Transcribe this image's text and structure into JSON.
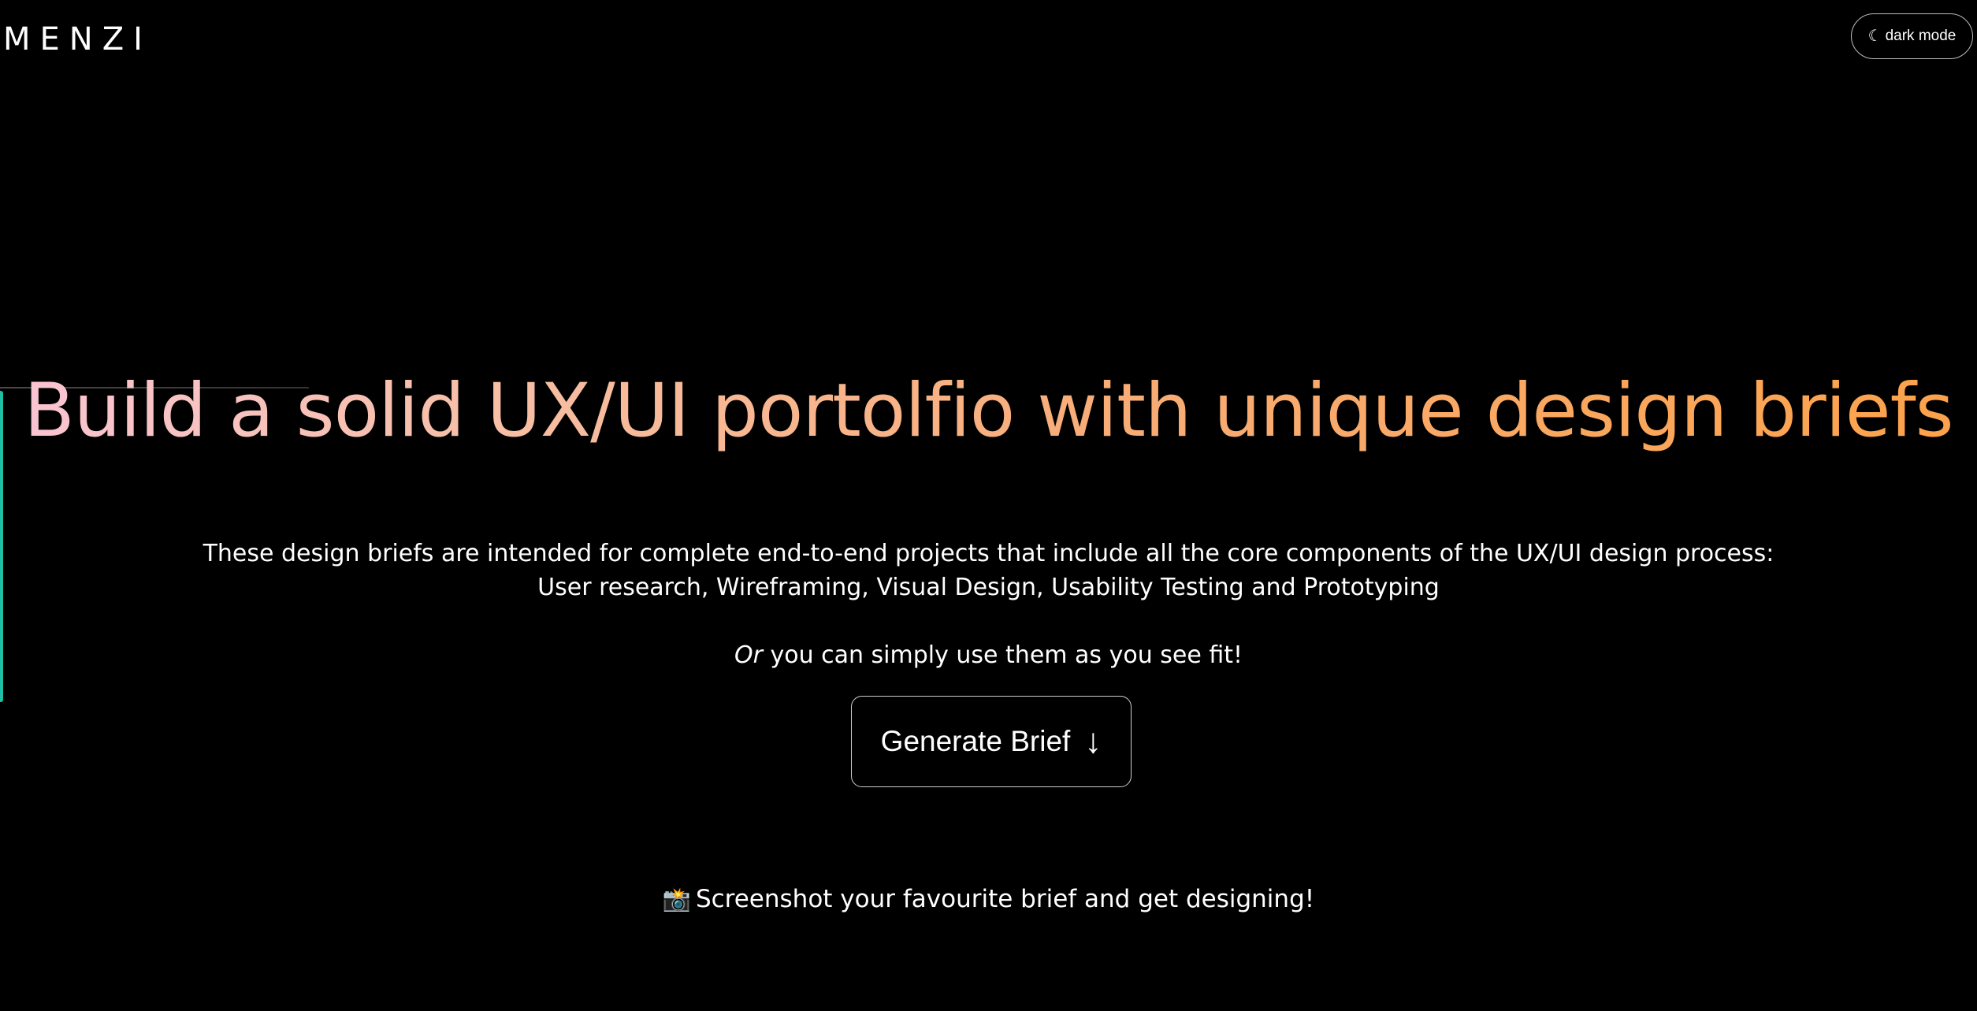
{
  "header": {
    "logo_text": "MENZI",
    "mode_toggle": {
      "icon": "moon-icon",
      "label": "dark mode"
    }
  },
  "hero": {
    "headline": "Build a solid UX/UI portolfio with unique design briefs",
    "intro_line_1": "These design briefs are intended for complete end-to-end projects that include all the core components of the UX/UI design process:",
    "intro_line_2": "User research, Wireframing, Visual Design, Usability Testing and Prototyping",
    "alt_emphasis": "Or",
    "alt_rest": "you can simply use them as you see fit!",
    "generate_button": {
      "label": "Generate Brief",
      "icon": "arrow-down-icon"
    },
    "tip": {
      "icon": "camera-flash-icon",
      "text": "Screenshot your favourite brief and get designing!"
    }
  },
  "colors": {
    "background": "#000000",
    "text": "#ffffff",
    "headline_gradient_start": "#f9c5d4",
    "headline_gradient_end": "#fca24a",
    "side_accent": "#1fbfa3"
  }
}
